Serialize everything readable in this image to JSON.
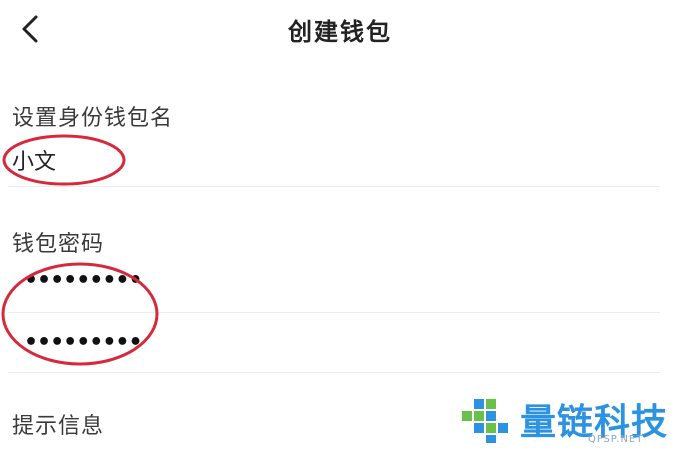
{
  "header": {
    "back_icon": "chevron-left-icon",
    "title": "创建钱包"
  },
  "form": {
    "name_label": "设置身份钱包名",
    "name_value": "小文",
    "password_label": "钱包密码",
    "password_mask": "•••••••••",
    "confirm_mask": "•••••••••",
    "hint_label": "提示信息"
  },
  "annotation": {
    "circle_color": "#d42a3b"
  },
  "watermark": {
    "text": "量链科技",
    "domain": "QFSP.NET",
    "color": "#2d92e0"
  }
}
